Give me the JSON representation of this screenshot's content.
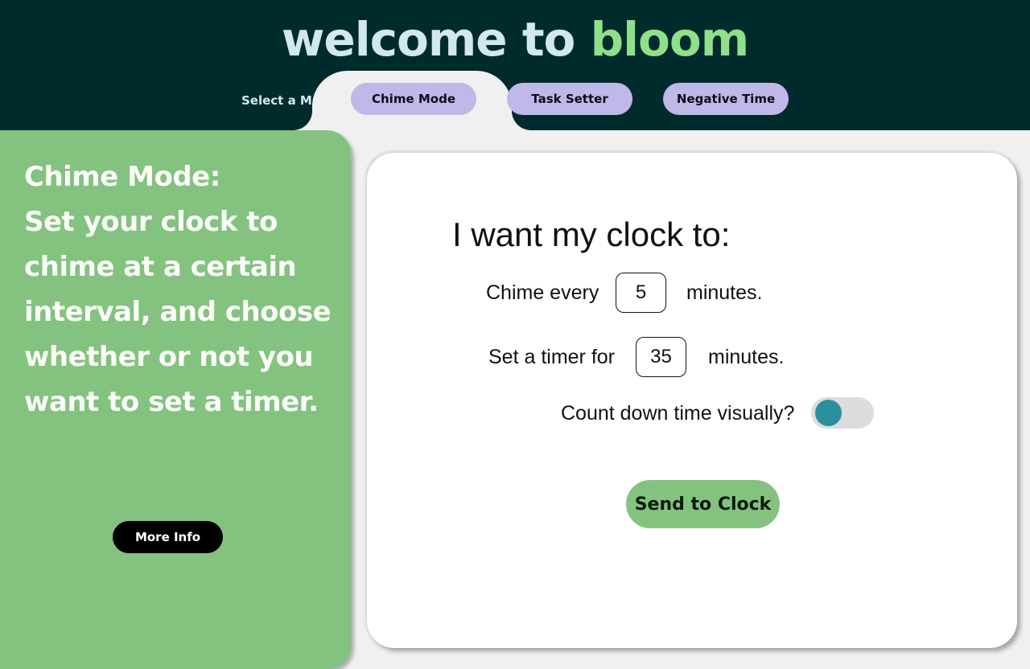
{
  "header": {
    "title_part1": "welcome to",
    "title_part2": "bloom",
    "mode_label": "Select a Mode:",
    "modes": [
      {
        "label": "Chime Mode",
        "selected": true
      },
      {
        "label": "Task Setter",
        "selected": false
      },
      {
        "label": "Negative Time",
        "selected": false
      }
    ]
  },
  "info_panel": {
    "heading": "Chime Mode:",
    "description": "Set your clock to chime at a certain interval, and choose whether or not you want to set a timer.",
    "more_info_label": "More Info"
  },
  "settings": {
    "title": "I want my clock to:",
    "chime_prefix": "Chime every",
    "chime_value": "5",
    "chime_suffix": "minutes.",
    "timer_prefix": "Set a timer for",
    "timer_value": "35",
    "timer_suffix": "minutes.",
    "countdown_label": "Count down time visually?",
    "countdown_enabled": false,
    "send_label": "Send to Clock"
  },
  "colors": {
    "header_bg": "#002b2d",
    "title_light": "#d2e8ee",
    "title_accent": "#8ee08a",
    "mode_button": "#c0b8e8",
    "panel_green": "#84c280",
    "toggle_knob": "#2a8f9f"
  }
}
